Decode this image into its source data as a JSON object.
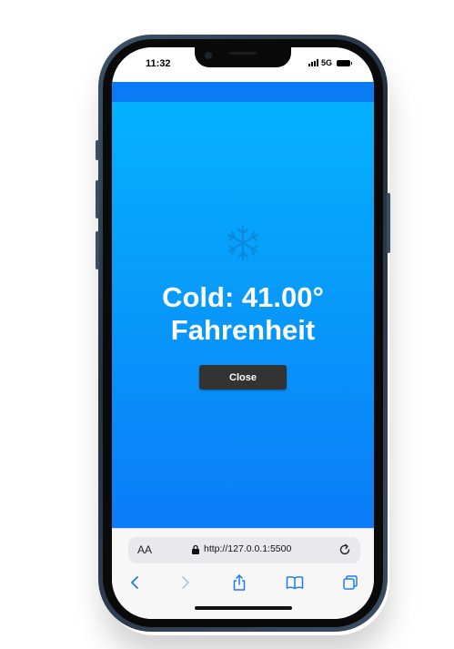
{
  "status_bar": {
    "time": "11:32",
    "network": "5G",
    "icons": [
      "signal-icon",
      "battery-icon"
    ]
  },
  "page": {
    "background_top": "#05b1ff",
    "background_bottom": "#0a7cf8",
    "accent_strip": "#0a7bf4",
    "weather_icon": "snowflake-icon",
    "temperature_line1": "Cold: 41.00°",
    "temperature_line2": "Fahrenheit",
    "close_label": "Close"
  },
  "browser": {
    "text_size_label": "AA",
    "url": "http://127.0.0.1:5500",
    "icons": [
      "lock-icon",
      "reload-icon",
      "back-icon",
      "forward-icon",
      "share-icon",
      "bookmarks-icon",
      "tabs-icon"
    ]
  }
}
